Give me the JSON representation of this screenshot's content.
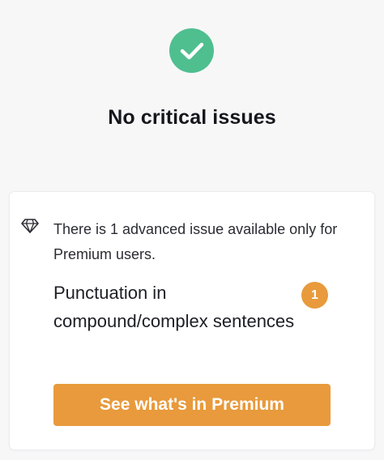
{
  "status": {
    "icon": "check-circle-icon",
    "title": "No critical issues",
    "color": "#4fbf8f"
  },
  "premium_card": {
    "icon": "diamond-icon",
    "note": "There is 1 advanced issue available only for Premium users.",
    "issue_title": "Punctuation in compound/complex sentences",
    "issue_count": "1",
    "button_label": "See what's in Premium",
    "accent_color": "#e89a3c"
  }
}
